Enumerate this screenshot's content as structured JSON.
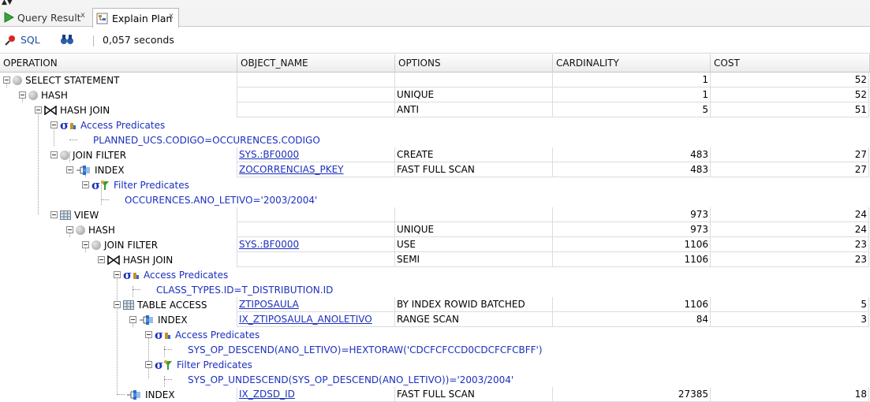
{
  "tabs": [
    {
      "label": "Query Result",
      "icon": "play-icon",
      "close": "x",
      "active": false
    },
    {
      "label": "Explain Plan",
      "icon": "explain-plan-icon",
      "close": "x",
      "active": true
    }
  ],
  "toolbar": {
    "sql_label": "SQL",
    "time": "0,057 seconds"
  },
  "columns": [
    "OPERATION",
    "OBJECT_NAME",
    "OPTIONS",
    "CARDINALITY",
    "COST"
  ],
  "rows": [
    {
      "op": "SELECT STATEMENT",
      "name": "",
      "opt": "",
      "card": "1",
      "cost": "52"
    },
    {
      "op": "HASH",
      "name": "",
      "opt": "UNIQUE",
      "card": "1",
      "cost": "52"
    },
    {
      "op": "HASH JOIN",
      "name": "",
      "opt": "ANTI",
      "card": "5",
      "cost": "51"
    },
    {
      "op": "Access Predicates",
      "name": "",
      "opt": "",
      "card": "",
      "cost": ""
    },
    {
      "op": "PLANNED_UCS.CODIGO=OCCURENCES.CODIGO",
      "name": "",
      "opt": "",
      "card": "",
      "cost": ""
    },
    {
      "op": "JOIN FILTER",
      "name": "SYS.:BF0000",
      "opt": "CREATE",
      "card": "483",
      "cost": "27"
    },
    {
      "op": "INDEX",
      "name": "ZOCORRENCIAS_PKEY",
      "opt": "FAST FULL SCAN",
      "card": "483",
      "cost": "27"
    },
    {
      "op": "Filter Predicates",
      "name": "",
      "opt": "",
      "card": "",
      "cost": ""
    },
    {
      "op": "OCCURENCES.ANO_LETIVO='2003/2004'",
      "name": "",
      "opt": "",
      "card": "",
      "cost": ""
    },
    {
      "op": "VIEW",
      "name": "",
      "opt": "",
      "card": "973",
      "cost": "24"
    },
    {
      "op": "HASH",
      "name": "",
      "opt": "UNIQUE",
      "card": "973",
      "cost": "24"
    },
    {
      "op": "JOIN FILTER",
      "name": "SYS.:BF0000",
      "opt": "USE",
      "card": "1106",
      "cost": "23"
    },
    {
      "op": "HASH JOIN",
      "name": "",
      "opt": "SEMI",
      "card": "1106",
      "cost": "23"
    },
    {
      "op": "Access Predicates",
      "name": "",
      "opt": "",
      "card": "",
      "cost": ""
    },
    {
      "op": "CLASS_TYPES.ID=T_DISTRIBUTION.ID",
      "name": "",
      "opt": "",
      "card": "",
      "cost": ""
    },
    {
      "op": "TABLE ACCESS",
      "name": "ZTIPOSAULA",
      "opt": "BY INDEX ROWID BATCHED",
      "card": "1106",
      "cost": "5"
    },
    {
      "op": "INDEX",
      "name": "IX_ZTIPOSAULA_ANOLETIVO",
      "opt": "RANGE SCAN",
      "card": "84",
      "cost": "3"
    },
    {
      "op": "Access Predicates",
      "name": "",
      "opt": "",
      "card": "",
      "cost": ""
    },
    {
      "op": "SYS_OP_DESCEND(ANO_LETIVO)=HEXTORAW('CDCFCFCCD0CDCFCFCBFF')",
      "name": "",
      "opt": "",
      "card": "",
      "cost": ""
    },
    {
      "op": "Filter Predicates",
      "name": "",
      "opt": "",
      "card": "",
      "cost": ""
    },
    {
      "op": "SYS_OP_UNDESCEND(SYS_OP_DESCEND(ANO_LETIVO))='2003/2004'",
      "name": "",
      "opt": "",
      "card": "",
      "cost": ""
    },
    {
      "op": "INDEX",
      "name": "IX_ZDSD_ID",
      "opt": "FAST FULL SCAN",
      "card": "27385",
      "cost": "18"
    }
  ]
}
